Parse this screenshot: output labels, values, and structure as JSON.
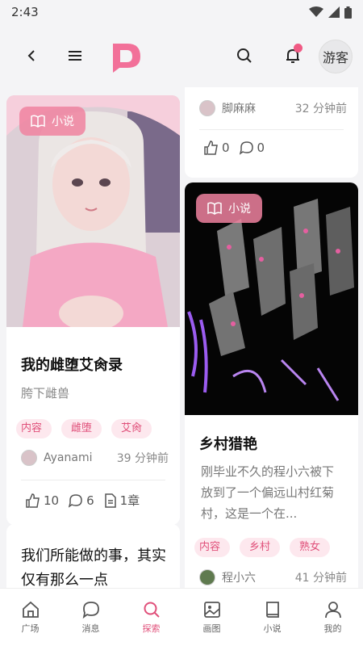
{
  "status": {
    "time": "2:43"
  },
  "header": {
    "guest_label": "游客"
  },
  "cards": [
    {
      "badge": "小说",
      "title": "我的雌堕艾肏录",
      "subtitle": "胯下雌兽",
      "tags": [
        "内容",
        "雌堕",
        "艾肏"
      ],
      "author": "Ayanami",
      "time": "39 分钟前",
      "likes": "10",
      "comments": "6",
      "chapters": "1章"
    },
    {
      "title": "我们所能做的事，其实仅有那么一点"
    },
    {
      "author": "脚麻麻",
      "time": "32 分钟前",
      "likes": "0",
      "comments": "0"
    },
    {
      "badge": "小说",
      "title": "乡村猎艳",
      "description": "刚毕业不久的程小六被下放到了一个偏远山村红菊村，这是一个在...",
      "tags": [
        "内容",
        "乡村",
        "熟女"
      ],
      "author": "程小六",
      "time": "41 分钟前"
    }
  ],
  "nav": [
    {
      "label": "广场",
      "icon": "home-icon"
    },
    {
      "label": "消息",
      "icon": "chat-icon"
    },
    {
      "label": "探索",
      "icon": "search-icon"
    },
    {
      "label": "画图",
      "icon": "image-icon"
    },
    {
      "label": "小说",
      "icon": "book-icon"
    },
    {
      "label": "我的",
      "icon": "user-icon"
    }
  ],
  "colors": {
    "accent": "#e0507a",
    "background": "#f4f4f6"
  }
}
